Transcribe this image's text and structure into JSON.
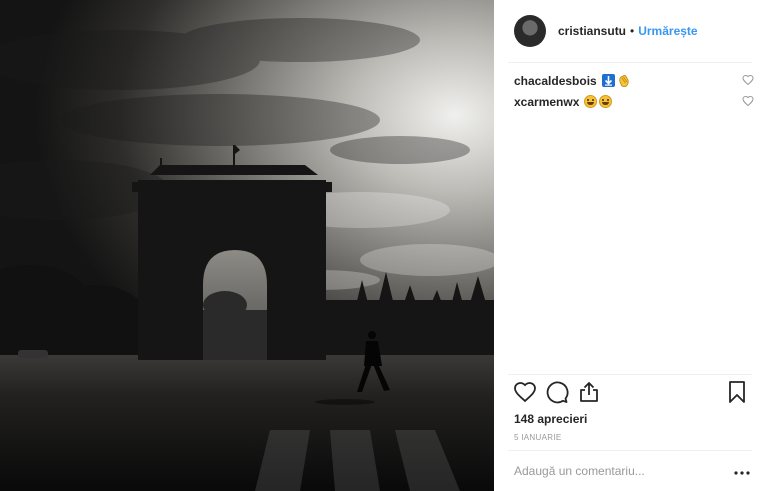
{
  "post": {
    "image_icon": "photo",
    "accent_color": "#3897f0"
  },
  "header": {
    "username": "cristiansutu",
    "separator": "•",
    "follow_label": "Urmărește"
  },
  "comments": [
    {
      "author": "chacaldesbois",
      "emojis": [
        "arrow-down-blue-emoji",
        "clapping-hands-emoji"
      ],
      "like_icon": "heart-outline-icon"
    },
    {
      "author": "xcarmenwx",
      "emojis": [
        "grinning-face-emoji",
        "grinning-face-emoji"
      ],
      "like_icon": "heart-outline-icon"
    }
  ],
  "actions": {
    "like_icon": "heart-icon",
    "comment_icon": "comment-bubble-icon",
    "share_icon": "share-icon",
    "save_icon": "bookmark-icon"
  },
  "likes_text": "148 aprecieri",
  "date_text": "5 IANUARIE",
  "comment_box": {
    "placeholder": "Adaugă un comentariu...",
    "more_icon": "more-options-icon"
  }
}
